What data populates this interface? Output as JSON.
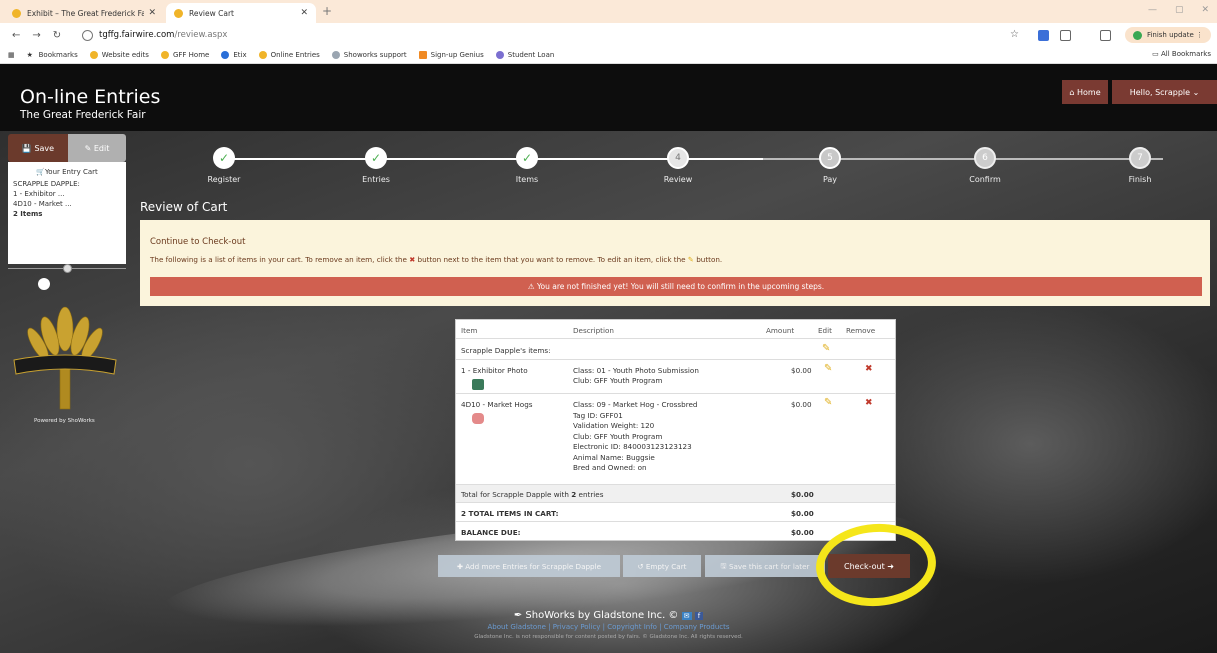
{
  "browser": {
    "tabs": [
      {
        "title": "Exhibit – The Great Frederick Fa",
        "active": false
      },
      {
        "title": "Review Cart",
        "active": true
      }
    ],
    "url_host": "tgffg.fairwire.com",
    "url_path": "/review.aspx",
    "finish_update": "Finish update",
    "bookmarks": [
      "Bookmarks",
      "Website edits",
      "GFF Home",
      "Etix",
      "Online Entries",
      "Showorks support",
      "Sign-up Genius",
      "Student Loan"
    ],
    "all_bookmarks": "All Bookmarks"
  },
  "header": {
    "title": "On-line Entries",
    "subtitle": "The Great Frederick Fair",
    "home": "Home",
    "user": "Hello, Scrapple"
  },
  "sidebar": {
    "save": "Save",
    "edit": "Edit",
    "cart_header": "Your Entry Cart",
    "lines": [
      "SCRAPPLE DAPPLE:",
      "1 - Exhibitor ...",
      "4D10 - Market ..."
    ],
    "count": "2 Items",
    "logo_text": "The Great Frederick Fair",
    "powered": "Powered by ShoWorks"
  },
  "steps": [
    {
      "label": "Register",
      "state": "done",
      "num": "1"
    },
    {
      "label": "Entries",
      "state": "done",
      "num": "2"
    },
    {
      "label": "Items",
      "state": "done",
      "num": "3"
    },
    {
      "label": "Review",
      "state": "current",
      "num": "4"
    },
    {
      "label": "Pay",
      "state": "pay",
      "num": "5"
    },
    {
      "label": "Confirm",
      "state": "todo",
      "num": "6"
    },
    {
      "label": "Finish",
      "state": "todo",
      "num": "7"
    }
  ],
  "review": {
    "title": "Review of Cart",
    "notice_heading": "Continue to Check-out",
    "notice_a": "The following is a list of items in your cart. To remove an item, click the ",
    "notice_b": " button next to the item that you want to remove. To edit an item, click the ",
    "notice_c": " button.",
    "alert": "You are not finished yet! You will still need to confirm in the upcoming steps."
  },
  "table": {
    "headers": {
      "item": "Item",
      "description": "Description",
      "amount": "Amount",
      "edit": "Edit",
      "remove": "Remove"
    },
    "group": "Scrapple Dapple's items:",
    "rows": [
      {
        "item": "1 - Exhibitor Photo",
        "desc": [
          "Class: 01 - Youth Photo Submission",
          "Club: GFF Youth Program"
        ],
        "amount": "$0.00"
      },
      {
        "item": "4D10 - Market Hogs",
        "desc": [
          "Class: 09 - Market Hog - Crossbred",
          "Tag ID: GFF01",
          "Validation Weight: 120",
          "Club: GFF Youth Program",
          "Electronic ID: 840003123123123",
          "Animal Name: Buggsie",
          "Bred and Owned: on"
        ],
        "amount": "$0.00"
      }
    ],
    "total_a": "Total for Scrapple Dapple with ",
    "total_b": "2",
    "total_c": " entries",
    "total_amount": "$0.00",
    "items_label": "2 TOTAL ITEMS IN CART:",
    "items_amount": "$0.00",
    "balance_label": "BALANCE DUE:",
    "balance_amount": "$0.00"
  },
  "buttons": {
    "add_more": "Add more Entries for Scrapple Dapple",
    "empty": "Empty Cart",
    "save_later": "Save this cart for later",
    "checkout": "Check-out"
  },
  "footer": {
    "brand": "ShoWorks by Gladstone Inc. ©",
    "links": "About Gladstone | Privacy Policy | Copyright Info | Company Products",
    "legal": "Gladstone Inc. is not responsible for content posted by fairs. © Gladstone Inc. All rights reserved."
  },
  "colors": {
    "accent": "#6b3a2c",
    "alert": "#d06050",
    "notice_bg": "#fbf4dc",
    "highlight": "#f5e61a"
  }
}
